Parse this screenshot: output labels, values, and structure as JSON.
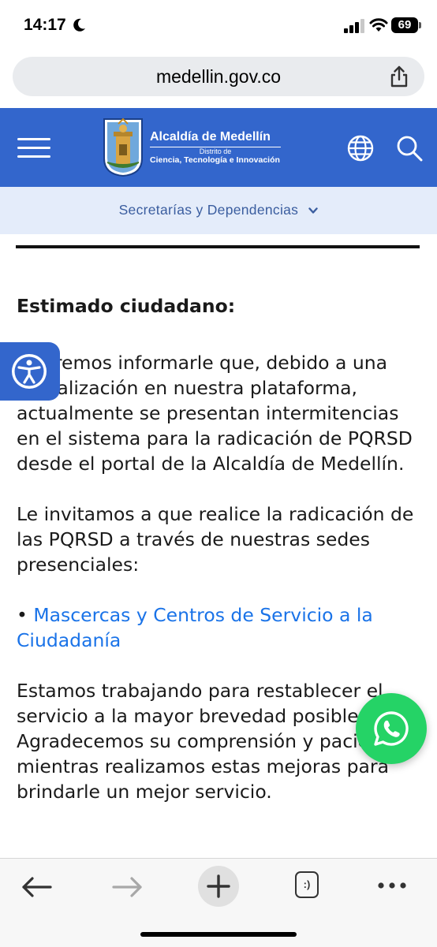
{
  "status": {
    "time": "14:17",
    "battery": "69"
  },
  "browser": {
    "url": "medellin.gov.co"
  },
  "header": {
    "logo_title": "Alcaldía de Medellín",
    "logo_sub1": "Distrito de",
    "logo_sub2": "Ciencia, Tecnología e Innovación",
    "brand_color": "#3366cc"
  },
  "subnav": {
    "label": "Secretarías y Dependencias"
  },
  "content": {
    "greeting": "Estimado ciudadano:",
    "para1": "Queremos informarle que, debido a una actualización en nuestra plataforma, actualmente se presentan intermitencias en el sistema para la radicación de PQRSD desde el portal de la Alcaldía de Medellín.",
    "para2": "Le invitamos a que realice la radicación de las PQRSD a través de nuestras sedes presenciales:",
    "bullet": "• ",
    "link": "Mascercas y Centros de Servicio a la Ciudadanía",
    "para3": "Estamos trabajando para restablecer el servicio a la mayor brevedad posible. Agradecemos su comprensión y paciencia mientras realizamos estas mejoras para brindarle un mejor servicio."
  },
  "toolbar": {
    "tabs_glyph": ":)"
  },
  "colors": {
    "accent": "#3366cc",
    "link": "#1a73e8",
    "whatsapp": "#25d366"
  }
}
